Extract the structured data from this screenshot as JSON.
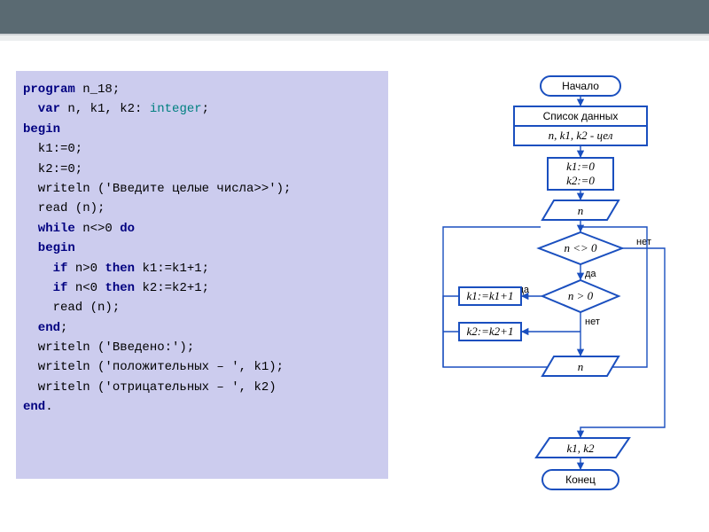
{
  "code": {
    "l1a": "program",
    "l1b": " n_18;",
    "l2a": "  var",
    "l2b": " n, k1, k2: ",
    "l2c": "integer",
    "l2d": ";",
    "l3": "begin",
    "l4": "  k1:=0;",
    "l5": "  k2:=0;",
    "l6a": "  writeln ('Введите целые числа>>');",
    "l7": "  read (n);",
    "l8a": "  while",
    "l8b": " n<>0 ",
    "l8c": "do",
    "l9": "  begin",
    "l10a": "    if",
    "l10b": " n>0 ",
    "l10c": "then",
    "l10d": " k1:=k1+1;",
    "l11a": "    if",
    "l11b": " n<0 ",
    "l11c": "then",
    "l11d": " k2:=k2+1;",
    "l12": "    read (n);",
    "l13a": "  end",
    "l13b": ";",
    "l14": "  writeln ('Введено:');",
    "l15": "  writeln ('положительных – ', k1);",
    "l16": "  writeln ('отрицательных – ', k2)",
    "l17a": "end",
    "l17b": "."
  },
  "flow": {
    "start": "Начало",
    "heading": "Список данных",
    "vars": "n, k1, k2 - цел",
    "init1": "k1:=0",
    "init2": "k2:=0",
    "in1": "n",
    "cond1": "n <> 0",
    "cond2": "n > 0",
    "assign1": "k1:=k1+1",
    "assign2": "k2:=k2+1",
    "in2": "n",
    "out": "k1, k2",
    "end": "Конец",
    "yes": "да",
    "no": "нет"
  }
}
